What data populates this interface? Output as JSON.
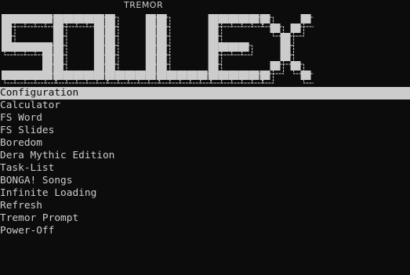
{
  "header": {
    "vendor": "TREMOR",
    "logo_text": "SOULEX"
  },
  "menu": {
    "selected_index": 0,
    "items": [
      {
        "label": "Configuration"
      },
      {
        "label": "Calculator"
      },
      {
        "label": "FS Word"
      },
      {
        "label": "FS Slides"
      },
      {
        "label": "Boredom"
      },
      {
        "label": "Dera Mythic Edition"
      },
      {
        "label": "Task-List"
      },
      {
        "label": "BONGA! Songs"
      },
      {
        "label": "Infinite Loading"
      },
      {
        "label": "Refresh"
      },
      {
        "label": "Tremor Prompt"
      },
      {
        "label": "Power-Off"
      }
    ]
  },
  "colors": {
    "background": "#0c0c0c",
    "foreground": "#cccccc",
    "selection_bg": "#cccccc",
    "selection_fg": "#0c0c0c"
  }
}
